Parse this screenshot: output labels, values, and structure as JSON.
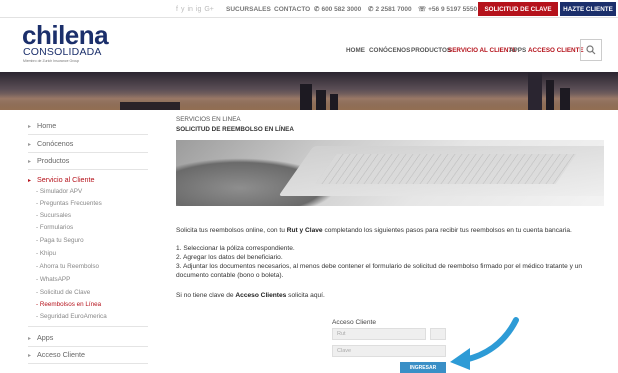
{
  "topbar": {
    "social_icons": [
      "f",
      "y",
      "in",
      "ig",
      "G+"
    ],
    "links": [
      "SUCURSALES",
      "CONTACTO"
    ],
    "phone1": "600 582 3000",
    "phone2": "2 2581 7000",
    "whatsapp": "+56 9 5197 5550",
    "solicitud_clave": "SOLICITUD DE CLAVE",
    "hazte_cliente": "HAZTE CLIENTE"
  },
  "logo": {
    "main": "chilena",
    "sub": "CONSOLIDADA",
    "tag": "Miembro de Zurich Insurance Group"
  },
  "nav": {
    "items": [
      "HOME",
      "CONÓCENOS",
      "PRODUCTOS",
      "SERVICIO AL CLIENTE",
      "APPS",
      "ACCESO CLIENTE"
    ]
  },
  "sidebar": {
    "items": [
      "Home",
      "Conócenos",
      "Productos",
      "Servicio al Cliente",
      "Apps",
      "Acceso Cliente"
    ],
    "sub_items": [
      "Simulador APV",
      "Preguntas Frecuentes",
      "Sucursales",
      "Formularios",
      "Paga tu Seguro",
      "Khipu",
      "Ahorra tu Reembolso",
      "WhatsAPP",
      "Solicitud de Clave",
      "Reembolsos en Línea",
      "Seguridad EuroAmerica"
    ]
  },
  "content": {
    "crumb1": "SERVICIOS EN LINEA",
    "crumb2": "SOLICITUD DE REEMBOLSO EN LÍNEA",
    "intro_pre": "Solicita tus reembolsos online, con tu ",
    "intro_bold": "Rut y Clave",
    "intro_post": " completando los siguientes pasos para recibir tus reembolsos en tu cuenta bancaria.",
    "step1": "1. Seleccionar la póliza correspondiente.",
    "step2": "2. Agregar los datos del beneficiario.",
    "step3": "3. Adjuntar los documentos necesarios, al menos debe contener el formulario de solicitud de reembolso firmado por el médico tratante y un documento contable (bono o boleta).",
    "no_clave_pre": "Si no tiene clave de ",
    "no_clave_bold": "Acceso Clientes",
    "no_clave_post": " solicita aquí."
  },
  "form": {
    "label": "Acceso Cliente",
    "rut_placeholder": "Rut",
    "clave_placeholder": "Clave",
    "submit": "INGRESAR"
  },
  "colors": {
    "brand_blue": "#1b2f6b",
    "accent_red": "#b5121b",
    "button_blue": "#3a8fc6",
    "arrow_blue": "#2d9bd6"
  }
}
